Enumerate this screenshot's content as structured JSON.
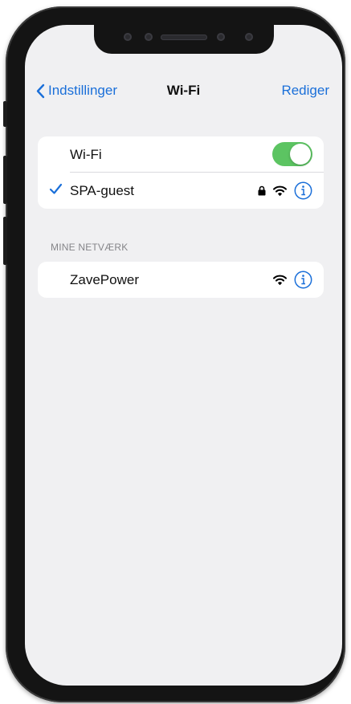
{
  "nav": {
    "back_label": "Indstillinger",
    "title": "Wi-Fi",
    "edit_label": "Rediger"
  },
  "wifi_group": {
    "toggle_label": "Wi-Fi",
    "toggle_on": true,
    "connected_network": {
      "name": "SPA-guest",
      "secured": true,
      "icons": [
        "checkmark-icon",
        "lock-icon",
        "wifi-signal-icon",
        "info-icon"
      ]
    }
  },
  "my_networks": {
    "header": "MINE NETVÆRK",
    "networks": [
      {
        "name": "ZavePower",
        "secured": false,
        "icons": [
          "wifi-signal-icon",
          "info-icon"
        ]
      }
    ]
  },
  "colors": {
    "accent": "#1a6fd9",
    "toggle_on": "#5cc462",
    "background": "#f0f0f2"
  }
}
